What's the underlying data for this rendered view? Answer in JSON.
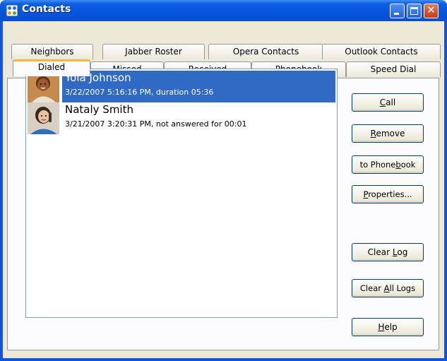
{
  "window": {
    "title": "Contacts",
    "controls": {
      "minimize": "minimize",
      "maximize": "maximize",
      "close": "✕"
    }
  },
  "tabs": {
    "row1": [
      "Neighbors",
      "Jabber Roster",
      "Opera Contacts",
      "Outlook Contacts"
    ],
    "row2": [
      "Dialed",
      "Missed",
      "Received",
      "Phonebook",
      "Speed Dial"
    ],
    "active": "Dialed"
  },
  "list": {
    "items": [
      {
        "name": "Yola Johnson",
        "detail": "3/22/2007 5:16:16 PM, duration 05:36",
        "selected": true
      },
      {
        "name": "Nataly Smith",
        "detail": "3/21/2007 3:20:31 PM, not answered for 00:01",
        "selected": false
      }
    ]
  },
  "buttons": {
    "call": {
      "pre": "",
      "u": "C",
      "post": "all"
    },
    "remove": {
      "pre": "",
      "u": "R",
      "post": "emove"
    },
    "to_phonebook": {
      "pre": "to Phone",
      "u": "b",
      "post": "ook"
    },
    "properties": {
      "pre": "",
      "u": "P",
      "post": "roperties..."
    },
    "clear_log": {
      "pre": "Clear ",
      "u": "L",
      "post": "og"
    },
    "clear_all_logs": {
      "pre": "Clear ",
      "u": "A",
      "post": "ll Logs"
    },
    "help": {
      "pre": "",
      "u": "H",
      "post": "elp"
    }
  },
  "colors": {
    "titlebar": "#0654dd",
    "selection": "#316ac5",
    "active_tab_accent": "#f4b63d",
    "face": "#ece9d8"
  }
}
